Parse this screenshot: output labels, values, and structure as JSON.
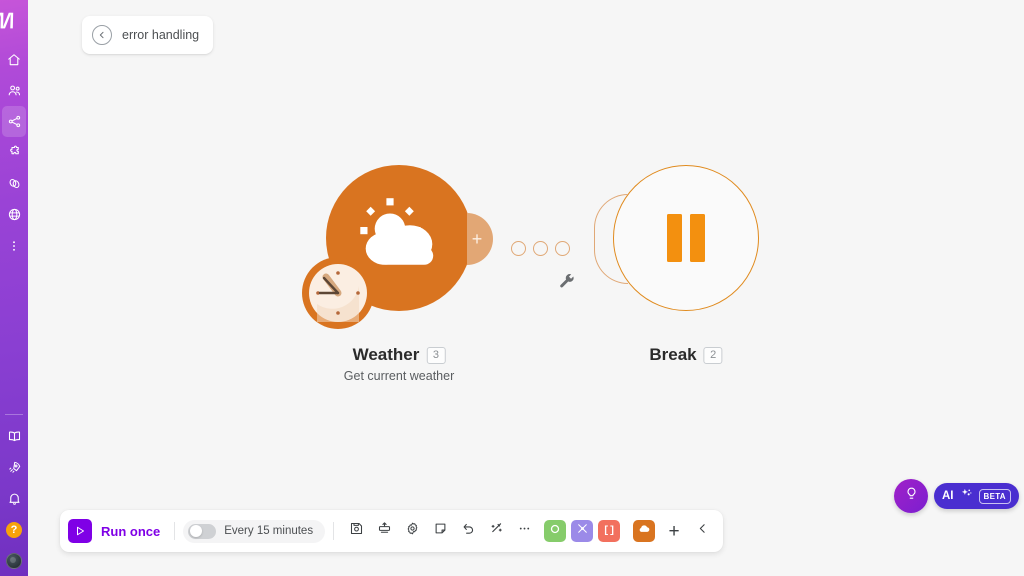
{
  "sidebar": {
    "logo": "make-logo",
    "top_items": [
      {
        "name": "home",
        "icon": "home-icon",
        "active": false
      },
      {
        "name": "teams",
        "icon": "users-icon",
        "active": false
      },
      {
        "name": "scenarios",
        "icon": "share-nodes-icon",
        "active": true
      },
      {
        "name": "templates",
        "icon": "puzzle-icon",
        "active": false
      },
      {
        "name": "connections",
        "icon": "chain-links-icon",
        "active": false
      },
      {
        "name": "webhooks",
        "icon": "globe-icon",
        "active": false
      },
      {
        "name": "more",
        "icon": "dots-vertical-icon",
        "active": false
      }
    ],
    "bottom_items": [
      {
        "name": "docs",
        "icon": "book-icon"
      },
      {
        "name": "whats-new",
        "icon": "rocket-icon"
      },
      {
        "name": "notifications",
        "icon": "bell-icon"
      }
    ],
    "help_label": "?",
    "accent_active": "#8a3fd2"
  },
  "breadcrumb": {
    "back_icon": "arrow-left-circle-icon",
    "label": "error handling"
  },
  "canvas": {
    "nodes": [
      {
        "id": "weather",
        "title": "Weather",
        "badge": "3",
        "subtitle": "Get current weather",
        "icon": "cloud-sun-icon",
        "schedule_icon": "clock-icon",
        "color": "#d97420",
        "plus_label": "+"
      },
      {
        "id": "break",
        "title": "Break",
        "badge": "2",
        "subtitle": "",
        "icon": "pause-icon",
        "color": "#f3900f"
      }
    ],
    "connector": {
      "dots": 3,
      "wrench_icon": "wrench-icon",
      "color": "#e0a876"
    }
  },
  "toolbar": {
    "run_label": "Run once",
    "run_icon": "play-icon",
    "schedule_toggle_on": false,
    "schedule_label": "Every 15 minutes",
    "tools": [
      {
        "name": "save",
        "icon": "floppy-disk-icon"
      },
      {
        "name": "io",
        "icon": "import-export-icon"
      },
      {
        "name": "settings",
        "icon": "gear-icon"
      },
      {
        "name": "notes",
        "icon": "sticky-note-icon"
      },
      {
        "name": "undo",
        "icon": "undo-arrow-icon"
      },
      {
        "name": "auto-align",
        "icon": "magic-wand-icon"
      },
      {
        "name": "more",
        "icon": "ellipsis-icon"
      }
    ],
    "app_chips": [
      {
        "name": "chip-green",
        "icon": "donut-icon",
        "color": "#86cc6b",
        "text": ""
      },
      {
        "name": "chip-purple",
        "icon": "tools-icon",
        "color": "#9b8ae8",
        "text": ""
      },
      {
        "name": "chip-red",
        "icon": "brackets-icon",
        "color": "#f2705e",
        "text": "[]"
      },
      {
        "name": "chip-orange",
        "icon": "cloud-icon",
        "color": "#d97420",
        "text": ""
      }
    ],
    "add_label": "+",
    "collapse_icon": "chevron-left-icon"
  },
  "floaters": {
    "bulb_icon": "lightbulb-icon",
    "ai_label": "AI",
    "ai_sparkle_icon": "sparkles-icon",
    "ai_beta_label": "BETA",
    "ai_color": "#4a2ed0"
  }
}
